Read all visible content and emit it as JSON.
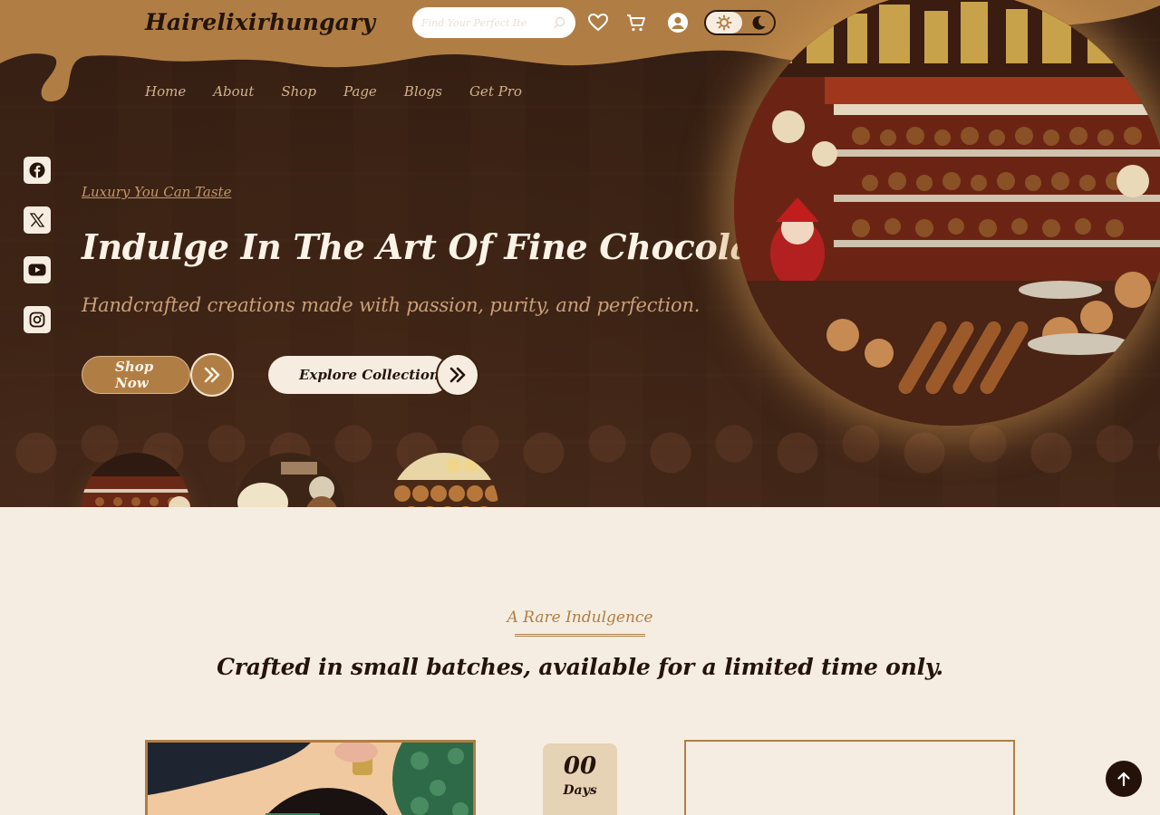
{
  "brand": {
    "logo_text": "Hairelixirhungary"
  },
  "search": {
    "placeholder": "Find Your Perfect Ite",
    "icon": "search-icon"
  },
  "header_icons": [
    "heart-icon",
    "cart-icon",
    "user-icon"
  ],
  "theme_toggle": {
    "light_icon": "sun-icon",
    "dark_icon": "moon-icon",
    "active": "light"
  },
  "nav": {
    "items": [
      {
        "label": "Home"
      },
      {
        "label": "About"
      },
      {
        "label": "Shop"
      },
      {
        "label": "Page"
      },
      {
        "label": "Blogs"
      },
      {
        "label": "Get Pro"
      }
    ]
  },
  "socials": [
    "facebook-icon",
    "x-icon",
    "youtube-icon",
    "instagram-icon"
  ],
  "hero": {
    "tagline": "Luxury You Can Taste",
    "headline": "Indulge In The Art Of Fine Chocolate",
    "subhead": "Handcrafted creations made with passion, purity, and perfection.",
    "primary_button": "Shop Now",
    "secondary_button": "Explore Collections",
    "active_thumbnail": 0
  },
  "limited": {
    "kicker": "A Rare Indulgence",
    "title": "Crafted in small batches, available for a limited time only.",
    "countdown": {
      "value": "00",
      "unit": "Days"
    }
  },
  "colors": {
    "accent": "#b07e45",
    "dark": "#24140a",
    "cream": "#f5ede1",
    "hero_text": "#fbf3e6"
  }
}
